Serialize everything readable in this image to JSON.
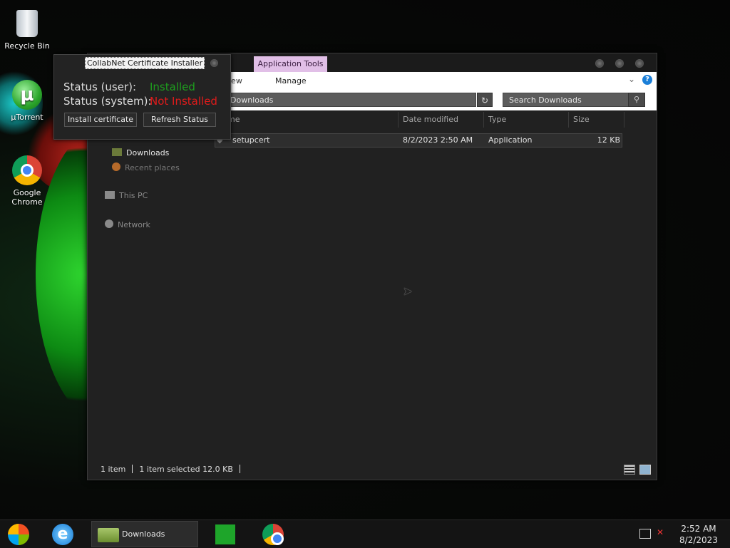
{
  "desktop": {
    "icons": [
      {
        "label": "Recycle Bin",
        "icon": "recycle-bin-icon"
      },
      {
        "label": "µTorrent",
        "icon": "utorrent-icon"
      },
      {
        "label": "Google Chrome",
        "icon": "chrome-icon"
      }
    ]
  },
  "explorer": {
    "ribbon": {
      "context_tab": "Application Tools",
      "view_tab": "iew",
      "manage_tab": "Manage",
      "help": "?"
    },
    "address": "Downloads",
    "search_placeholder": "Search Downloads",
    "columns": [
      "me",
      "Date modified",
      "Type",
      "Size"
    ],
    "files": [
      {
        "name": "setupcert",
        "date": "8/2/2023 2:50 AM",
        "type": "Application",
        "size": "12 KB"
      }
    ],
    "nav": {
      "downloads": "Downloads",
      "recent": "Recent places",
      "this_pc": "This PC",
      "network": "Network"
    },
    "status": {
      "count": "1 item",
      "selected": "1 item selected  12.0 KB"
    }
  },
  "cert_installer": {
    "title": "CollabNet Certificate Installer",
    "user_label": "Status (user):",
    "user_value": "Installed",
    "system_label": "Status (system):",
    "system_value": "Not Installed",
    "install_button": "Install certificate",
    "refresh_button": "Refresh Status",
    "colors": {
      "installed": "#1e9e1e",
      "not_installed": "#e01b1b"
    }
  },
  "taskbar": {
    "active_window": "Downloads",
    "time": "2:52 AM",
    "date": "8/2/2023"
  }
}
